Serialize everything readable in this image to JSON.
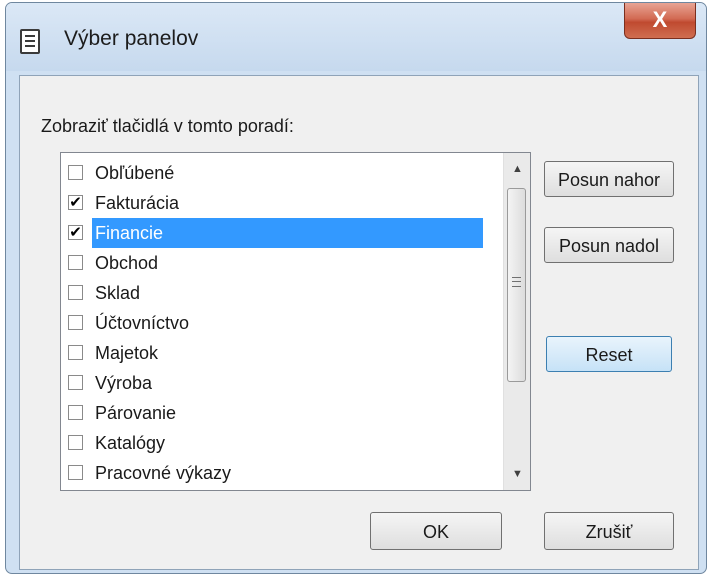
{
  "window": {
    "title": "Výber panelov",
    "close_label": "X"
  },
  "prompt": "Zobraziť tlačidlá v tomto poradí:",
  "panels": [
    {
      "label": "Obľúbené",
      "checked": false,
      "selected": false
    },
    {
      "label": "Fakturácia",
      "checked": true,
      "selected": false
    },
    {
      "label": "Financie",
      "checked": true,
      "selected": true
    },
    {
      "label": "Obchod",
      "checked": false,
      "selected": false
    },
    {
      "label": "Sklad",
      "checked": false,
      "selected": false
    },
    {
      "label": "Účtovníctvo",
      "checked": false,
      "selected": false
    },
    {
      "label": "Majetok",
      "checked": false,
      "selected": false
    },
    {
      "label": "Výroba",
      "checked": false,
      "selected": false
    },
    {
      "label": "Párovanie",
      "checked": false,
      "selected": false
    },
    {
      "label": "Katalógy",
      "checked": false,
      "selected": false
    },
    {
      "label": "Pracovné výkazy",
      "checked": false,
      "selected": false
    }
  ],
  "buttons": {
    "move_up": "Posun nahor",
    "move_down": "Posun nadol",
    "reset": "Reset",
    "ok": "OK",
    "cancel": "Zrušiť"
  },
  "colors": {
    "selection": "#3399ff",
    "selection_text": "#ffffff",
    "close_button": "#c94f35"
  }
}
